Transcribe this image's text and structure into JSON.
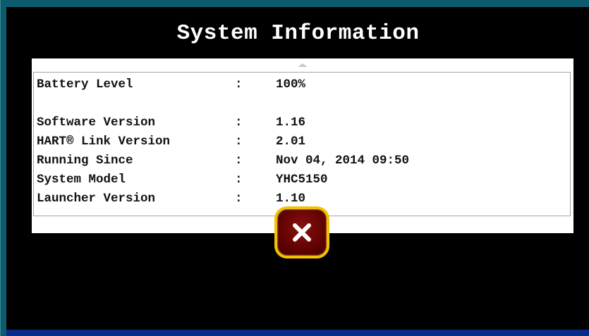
{
  "dialog": {
    "title": "System Information",
    "rows": [
      {
        "label": "Battery Level",
        "separator": ":",
        "value": "100%"
      },
      {
        "label": "Software Version",
        "separator": ":",
        "value": "1.16"
      },
      {
        "label": "HART® Link Version",
        "separator": ":",
        "value": "2.01"
      },
      {
        "label": "Running Since",
        "separator": ":",
        "value": "Nov 04, 2014 09:50"
      },
      {
        "label": "System Model",
        "separator": ":",
        "value": "YHC5150"
      },
      {
        "label": "Launcher Version",
        "separator": ":",
        "value": "1.10"
      }
    ],
    "close_icon": "close-x-icon",
    "colors": {
      "background": "#000000",
      "frame": "#0d5b6e",
      "button_fill": "#6a0000",
      "button_border": "#f2c200"
    }
  }
}
